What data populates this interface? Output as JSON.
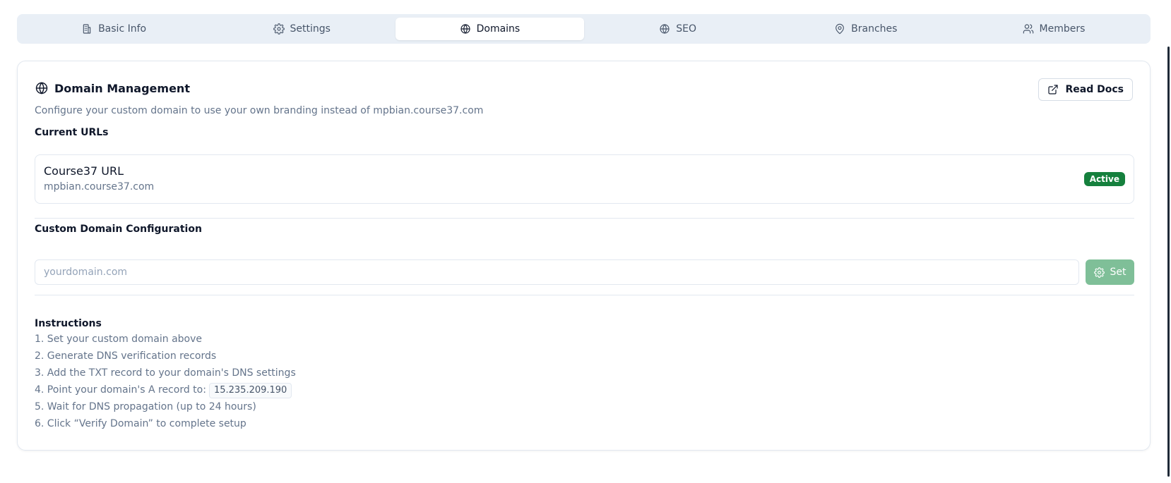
{
  "tabs": [
    {
      "label": "Basic Info",
      "icon": "building-icon",
      "active": false
    },
    {
      "label": "Settings",
      "icon": "gear-icon",
      "active": false
    },
    {
      "label": "Domains",
      "icon": "globe-icon",
      "active": true
    },
    {
      "label": "SEO",
      "icon": "globe-icon",
      "active": false
    },
    {
      "label": "Branches",
      "icon": "map-pin-icon",
      "active": false
    },
    {
      "label": "Members",
      "icon": "users-icon",
      "active": false
    }
  ],
  "card": {
    "title": "Domain Management",
    "read_docs_label": "Read Docs",
    "description": "Configure your custom domain to use your own branding instead of mpbian.course37.com"
  },
  "current_urls": {
    "label": "Current URLs",
    "title": "Course37 URL",
    "value": "mpbian.course37.com",
    "status": "Active",
    "status_color": "#15803d"
  },
  "custom_domain": {
    "label": "Custom Domain Configuration",
    "placeholder": "yourdomain.com",
    "value": "",
    "set_label": "Set"
  },
  "instructions": {
    "title": "Instructions",
    "steps": [
      "1. Set your custom domain above",
      "2. Generate DNS verification records",
      "3. Add the TXT record to your domain's DNS settings",
      "4. Point your domain's A record to:",
      "5. Wait for DNS propagation (up to 24 hours)",
      "6. Click “Verify Domain” to complete setup"
    ],
    "ip_address": "15.235.209.190"
  }
}
